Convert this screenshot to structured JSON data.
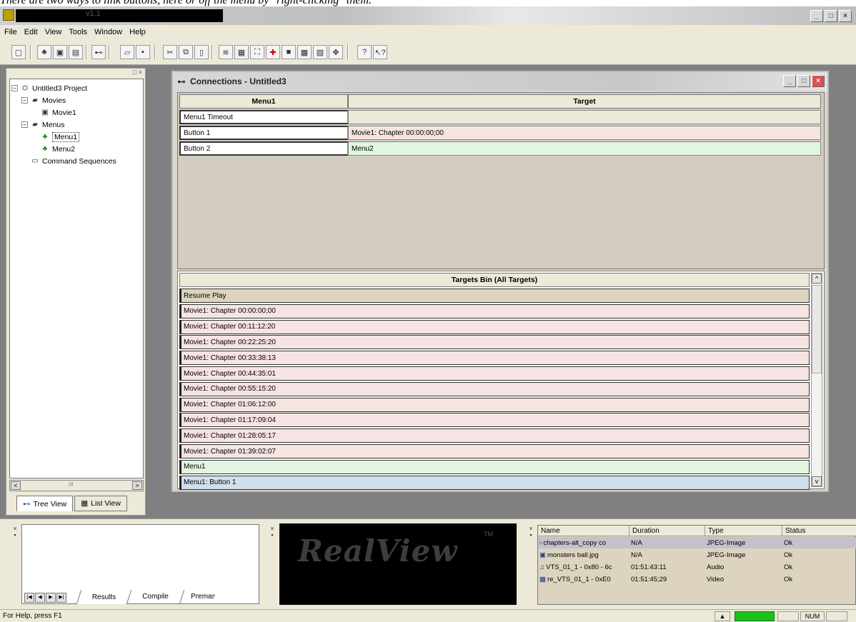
{
  "caption": "There are two ways to link buttons, here or off the menu by \"right-clicking\" them.",
  "window": {
    "title": "v1.1",
    "min": "_",
    "max": "□",
    "close": "×"
  },
  "menu": [
    "File",
    "Edit",
    "View",
    "Tools",
    "Window",
    "Help"
  ],
  "left_panel": {
    "close_glyph": "□ ×",
    "tree": [
      {
        "label": "Untitled3 Project",
        "level": 0,
        "toggle": "−",
        "icon": "project-icon",
        "glyph": "⛭"
      },
      {
        "label": "Movies",
        "level": 1,
        "toggle": "−",
        "icon": "folder-icon",
        "glyph": "▰"
      },
      {
        "label": "Movie1",
        "level": 2,
        "toggle": "",
        "icon": "movie-icon",
        "glyph": "▣"
      },
      {
        "label": "Menus",
        "level": 1,
        "toggle": "−",
        "icon": "folder-icon",
        "glyph": "▰"
      },
      {
        "label": "Menu1",
        "level": 2,
        "toggle": "",
        "icon": "menu-icon",
        "glyph": "♣",
        "selected": true
      },
      {
        "label": "Menu2",
        "level": 2,
        "toggle": "",
        "icon": "menu-icon",
        "glyph": "♣"
      },
      {
        "label": "Command Sequences",
        "level": 1,
        "toggle": "",
        "icon": "folder-icon",
        "glyph": "▭"
      }
    ],
    "scroll_left": "<",
    "scroll_mid": "III",
    "scroll_right": ">",
    "tabs": [
      {
        "label": "Tree View",
        "glyph": "⊷",
        "active": true
      },
      {
        "label": "List View",
        "glyph": "▦",
        "active": false
      }
    ]
  },
  "connections": {
    "title": "Connections - Untitled3",
    "headers": [
      "Menu1",
      "Target"
    ],
    "rows": [
      {
        "source": "Menu1 Timeout",
        "target": "",
        "color": "#ece9d8"
      },
      {
        "source": "Button 1",
        "target": "Movie1: Chapter 00:00:00;00",
        "color": "#f5e4e1"
      },
      {
        "source": "Button 2",
        "target": "Menu2",
        "color": "#e2f5e0"
      }
    ],
    "bin_title": "Targets Bin (All Targets)",
    "bin": [
      {
        "label": "Resume Play",
        "color": "#ddd4bf"
      },
      {
        "label": "Movie1: Chapter 00:00:00;00",
        "color": "#f5e4e1"
      },
      {
        "label": "Movie1: Chapter 00:11:12:20",
        "color": "#f5e4e1"
      },
      {
        "label": "Movie1: Chapter 00:22:25:20",
        "color": "#f5e4e1"
      },
      {
        "label": "Movie1: Chapter 00:33:38:13",
        "color": "#f5e4e1"
      },
      {
        "label": "Movie1: Chapter 00:44:35:01",
        "color": "#f5e4e1"
      },
      {
        "label": "Movie1: Chapter 00:55:15:20",
        "color": "#f5e4e1"
      },
      {
        "label": "Movie1: Chapter 01:06:12:00",
        "color": "#f5e4e1"
      },
      {
        "label": "Movie1: Chapter 01:17:09:04",
        "color": "#f5e4e1"
      },
      {
        "label": "Movie1: Chapter 01:28:05:17",
        "color": "#f5e4e1"
      },
      {
        "label": "Movie1: Chapter 01:39:02:07",
        "color": "#f5e4e1"
      },
      {
        "label": "Menu1",
        "color": "#e2f5e0"
      },
      {
        "label": "Menu1: Button 1",
        "color": "#cfe0ec"
      }
    ],
    "scroll_up": "^",
    "scroll_down": "v"
  },
  "results_tabs": [
    "Results",
    "Compile",
    "Premaster"
  ],
  "results_nav": [
    "|◀",
    "◀",
    "▶",
    "▶|"
  ],
  "realview": {
    "logo": "RealView",
    "tm": "TM"
  },
  "files": {
    "headers": [
      "Name",
      "Duration",
      "Type",
      "Status"
    ],
    "rows": [
      {
        "glyph": "▫",
        "name": "chapters-alt_copy co",
        "duration": "N/A",
        "type": "JPEG-Image",
        "status": "Ok",
        "selected": true
      },
      {
        "glyph": "▣",
        "name": "monsters ball.jpg",
        "duration": "N/A",
        "type": "JPEG-Image",
        "status": "Ok",
        "selected": false
      },
      {
        "glyph": "♫",
        "name": "VTS_01_1 - 0x80 - 6c",
        "duration": "01:51:43:11",
        "type": "Audio",
        "status": "Ok",
        "selected": false
      },
      {
        "glyph": "▩",
        "name": "re_VTS_01_1 - 0xE0",
        "duration": "01:51:45;29",
        "type": "Video",
        "status": "Ok",
        "selected": false
      }
    ]
  },
  "status": {
    "message": "For Help, press F1",
    "num": "NUM",
    "progress_glyph": "▲"
  }
}
